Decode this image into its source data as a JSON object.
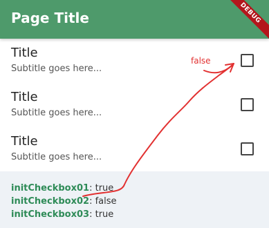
{
  "appbar": {
    "title": "Page Title",
    "debug_banner": "DEBUG",
    "color": "#4e9a6b"
  },
  "list": {
    "items": [
      {
        "title": "Title",
        "subtitle": "Subtitle goes here...",
        "checked": false
      },
      {
        "title": "Title",
        "subtitle": "Subtitle goes here...",
        "checked": false
      },
      {
        "title": "Title",
        "subtitle": "Subtitle goes here...",
        "checked": false
      }
    ]
  },
  "annotation": {
    "text": "false",
    "color": "#e23131"
  },
  "status": {
    "lines": [
      {
        "key": "initCheckbox01",
        "sep": ":",
        "value": "true"
      },
      {
        "key": "initCheckbox02",
        "sep": ":",
        "value": "false"
      },
      {
        "key": "initCheckbox03",
        "sep": ":",
        "value": "true"
      }
    ]
  }
}
